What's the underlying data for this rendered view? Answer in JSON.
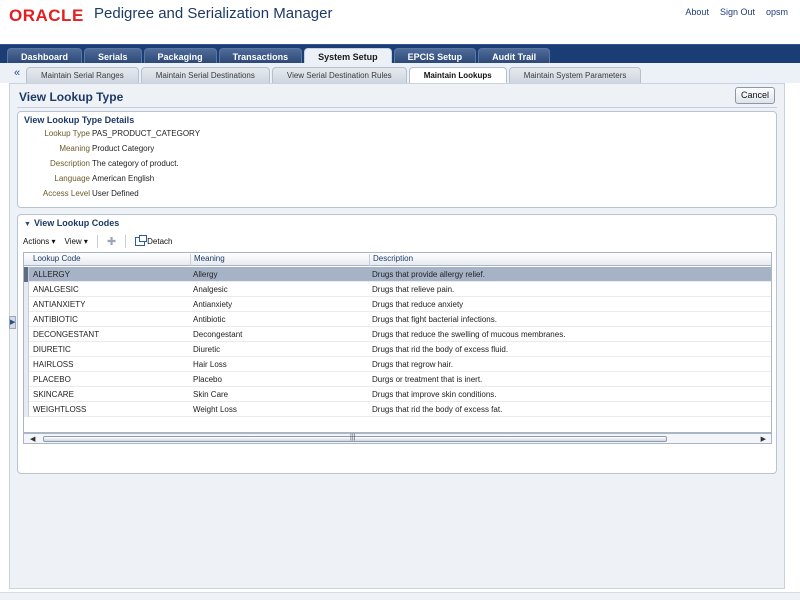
{
  "header": {
    "logo": "ORACLE",
    "app_title": "Pedigree and Serialization Manager",
    "links": [
      "About",
      "Sign Out",
      "opsm"
    ]
  },
  "tabs": [
    "Dashboard",
    "Serials",
    "Packaging",
    "Transactions",
    "System Setup",
    "EPCIS Setup",
    "Audit Trail"
  ],
  "active_tab": "System Setup",
  "subtabs": [
    "Maintain Serial Ranges",
    "Maintain Serial Destinations",
    "View Serial Destination Rules",
    "Maintain Lookups",
    "Maintain System Parameters"
  ],
  "active_subtab": "Maintain Lookups",
  "page": {
    "title": "View Lookup Type",
    "cancel_label": "Cancel"
  },
  "details": {
    "header": "View Lookup Type Details",
    "fields": [
      {
        "label": "Lookup Type",
        "value": "PAS_PRODUCT_CATEGORY"
      },
      {
        "label": "Meaning",
        "value": "Product Category"
      },
      {
        "label": "Description",
        "value": "The category of product."
      },
      {
        "label": "Language",
        "value": "American English"
      },
      {
        "label": "Access Level",
        "value": "User Defined"
      }
    ]
  },
  "codes": {
    "header": "View Lookup Codes",
    "toolbar": {
      "actions": "Actions",
      "view": "View",
      "detach": "Detach"
    },
    "columns": [
      "Lookup Code",
      "Meaning",
      "Description"
    ],
    "rows": [
      {
        "code": "ALLERGY",
        "meaning": "Allergy",
        "description": "Drugs that provide allergy relief."
      },
      {
        "code": "ANALGESIC",
        "meaning": "Analgesic",
        "description": "Drugs that relieve pain."
      },
      {
        "code": "ANTIANXIETY",
        "meaning": "Antianxiety",
        "description": "Drugs that reduce anxiety"
      },
      {
        "code": "ANTIBIOTIC",
        "meaning": "Antibiotic",
        "description": "Drugs that fight bacterial infections."
      },
      {
        "code": "DECONGESTANT",
        "meaning": "Decongestant",
        "description": "Drugs that reduce the swelling of mucous membranes."
      },
      {
        "code": "DIURETIC",
        "meaning": "Diuretic",
        "description": "Drugs that rid the body of excess fluid."
      },
      {
        "code": "HAIRLOSS",
        "meaning": "Hair Loss",
        "description": "Drugs that regrow hair."
      },
      {
        "code": "PLACEBO",
        "meaning": "Placebo",
        "description": "Durgs or treatment that is inert."
      },
      {
        "code": "SKINCARE",
        "meaning": "Skin Care",
        "description": "Drugs that improve skin conditions."
      },
      {
        "code": "WEIGHTLOSS",
        "meaning": "Weight Loss",
        "description": "Drugs that rid the body of excess fat."
      }
    ],
    "selected_row": 0
  }
}
